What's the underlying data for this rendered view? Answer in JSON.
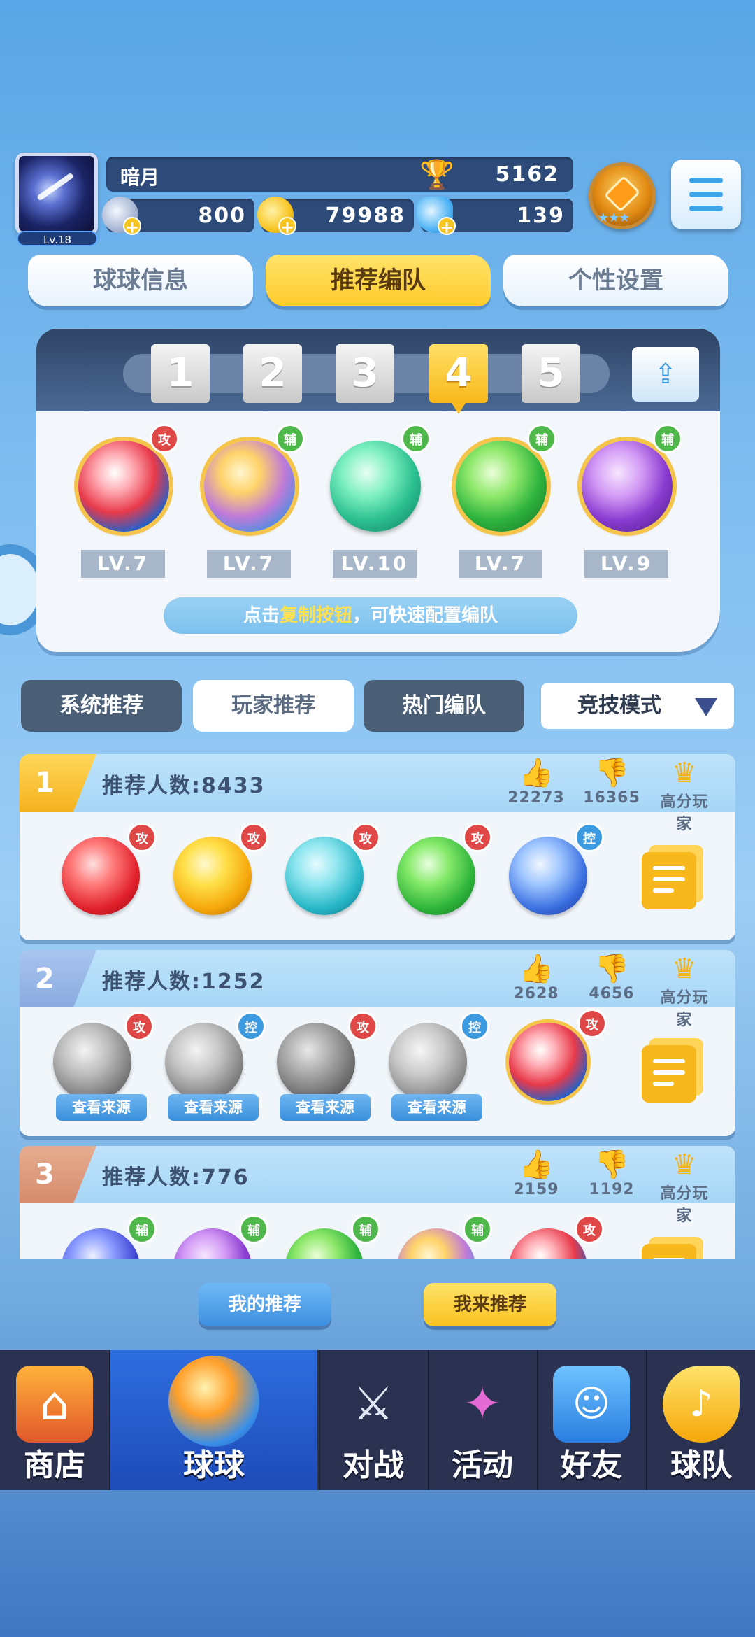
{
  "player": {
    "name": "暗月",
    "level": "Lv.18",
    "trophies": "5162",
    "currency": {
      "silver": "800",
      "gold": "79988",
      "diamond": "139"
    }
  },
  "tabs": [
    {
      "label": "球球信息",
      "active": false
    },
    {
      "label": "推荐编队",
      "active": true
    },
    {
      "label": "个性设置",
      "active": false
    }
  ],
  "team_selector": {
    "numbers": [
      "1",
      "2",
      "3",
      "4",
      "5"
    ],
    "active": "4"
  },
  "current_team": {
    "balls": [
      {
        "tag": "攻",
        "tag_type": "atk",
        "level": "LV.7",
        "icon": "wave-ball-icon"
      },
      {
        "tag": "辅",
        "tag_type": "sup",
        "level": "LV.7",
        "icon": "crowd-ball-icon"
      },
      {
        "tag": "辅",
        "tag_type": "sup",
        "level": "LV.10",
        "icon": "sp-ball-icon"
      },
      {
        "tag": "辅",
        "tag_type": "sup",
        "level": "LV.7",
        "icon": "star-arrow-ball-icon"
      },
      {
        "tag": "辅",
        "tag_type": "sup",
        "level": "LV.9",
        "icon": "leaf-ball-icon"
      }
    ],
    "hint_prefix": "点击",
    "hint_highlight": "复制按钮",
    "hint_suffix": "，可快速配置编队"
  },
  "filters": {
    "system": "系统推荐",
    "player": "玩家推荐",
    "hot": "热门编队",
    "mode": "竞技模式"
  },
  "recommendations": [
    {
      "rank": "1",
      "count_label": "推荐人数:8433",
      "likes": "22273",
      "dislikes": "16365",
      "high_label": "高分玩家",
      "balls": [
        {
          "tag": "攻",
          "tag_type": "atk"
        },
        {
          "tag": "攻",
          "tag_type": "atk"
        },
        {
          "tag": "攻",
          "tag_type": "atk"
        },
        {
          "tag": "攻",
          "tag_type": "atk"
        },
        {
          "tag": "控",
          "tag_type": "ctl"
        }
      ]
    },
    {
      "rank": "2",
      "count_label": "推荐人数:1252",
      "likes": "2628",
      "dislikes": "4656",
      "high_label": "高分玩家",
      "source_label": "查看来源",
      "balls": [
        {
          "tag": "攻",
          "tag_type": "atk"
        },
        {
          "tag": "控",
          "tag_type": "ctl"
        },
        {
          "tag": "攻",
          "tag_type": "atk"
        },
        {
          "tag": "控",
          "tag_type": "ctl"
        },
        {
          "tag": "攻",
          "tag_type": "atk"
        }
      ]
    },
    {
      "rank": "3",
      "count_label": "推荐人数:776",
      "likes": "2159",
      "dislikes": "1192",
      "high_label": "高分玩家",
      "balls": [
        {
          "tag": "辅",
          "tag_type": "sup"
        },
        {
          "tag": "辅",
          "tag_type": "sup"
        },
        {
          "tag": "辅",
          "tag_type": "sup"
        },
        {
          "tag": "辅",
          "tag_type": "sup"
        },
        {
          "tag": "攻",
          "tag_type": "atk"
        }
      ]
    }
  ],
  "bottom_buttons": {
    "mine": "我的推荐",
    "recommend": "我来推荐"
  },
  "nav": [
    {
      "label": "商店",
      "icon": "shop-icon",
      "active": false
    },
    {
      "label": "球球",
      "icon": "balls-icon",
      "active": true
    },
    {
      "label": "对战",
      "icon": "crossed-swords-icon",
      "active": false
    },
    {
      "label": "活动",
      "icon": "party-popper-icon",
      "active": false
    },
    {
      "label": "好友",
      "icon": "friends-book-icon",
      "active": false
    },
    {
      "label": "球队",
      "icon": "whistle-icon",
      "active": false
    }
  ]
}
